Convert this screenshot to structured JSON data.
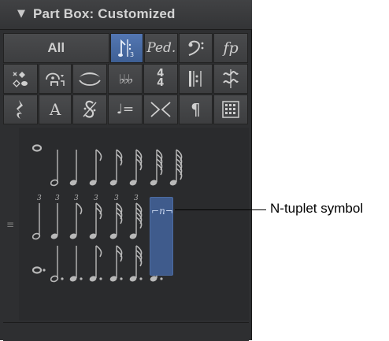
{
  "panel": {
    "title": "Part Box: Customized"
  },
  "tabs": {
    "all_label": "All",
    "row1_icons": [
      "notes-tuplet-icon",
      "pedal-icon",
      "bass-clef-icon",
      "dynamics-fp-icon"
    ],
    "pedal_text": "Ped.",
    "dynamics_text": "fp",
    "row2_icons": [
      "noteheads-icon",
      "articulation-icon",
      "slur-icon",
      "accidentals-icon",
      "time-signature-icon",
      "repeat-icon",
      "ornament-icon"
    ],
    "time_sig_top": "4",
    "time_sig_bottom": "4",
    "flats_text": "♭♭♭",
    "row3_icons": [
      "rest-icon",
      "text-icon",
      "segno-icon",
      "tempo-icon",
      "hairpin-icon",
      "paragraph-icon",
      "grid-icon"
    ],
    "text_glyph": "A",
    "paragraph_glyph": "¶",
    "tempo_text": "♩="
  },
  "notes_area": {
    "selected_symbol_glyph": "⌐n¬"
  },
  "callout": {
    "label": "N-tuplet symbol"
  }
}
